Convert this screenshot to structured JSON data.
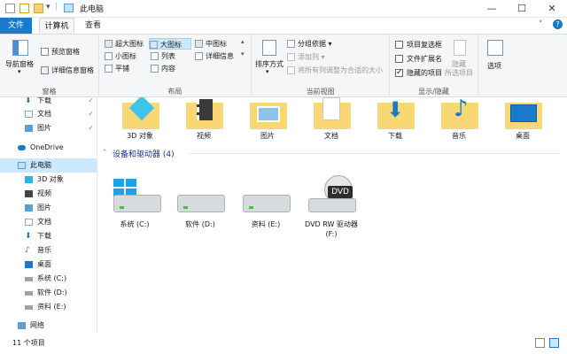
{
  "window": {
    "title": "此电脑",
    "controls": [
      "minimize-icon",
      "maximize-icon",
      "close-icon"
    ]
  },
  "tabs": {
    "file": "文件",
    "computer": "计算机",
    "view": "查看"
  },
  "ribbon": {
    "pane_group": {
      "nav_pane": "导航窗格",
      "preview_pane": "预览窗格",
      "details_pane": "详细信息窗格",
      "label": "窗格"
    },
    "layout_group": {
      "items": [
        "超大图标",
        "大图标",
        "中图标",
        "小图标",
        "列表",
        "详细信息",
        "平铺",
        "内容"
      ],
      "selected": "大图标",
      "label": "布局"
    },
    "current_view_group": {
      "sort_by": "排序方式",
      "group_by": "分组依据",
      "add_column": "添加列",
      "size_columns": "将所有列调整为合适的大小",
      "label": "当前视图"
    },
    "show_hide_group": {
      "item_checkboxes": "项目复选框",
      "file_extensions": "文件扩展名",
      "hidden_items": "隐藏的项目",
      "hidden_items_checked": true,
      "hide_selected_1": "隐藏",
      "hide_selected_2": "所选项目",
      "label": "显示/隐藏"
    },
    "options": "选项"
  },
  "nav": {
    "items": [
      {
        "label": "下载",
        "pinned": true
      },
      {
        "label": "文档",
        "pinned": true
      },
      {
        "label": "图片",
        "pinned": true
      },
      {
        "label": "OneDrive"
      },
      {
        "label": "此电脑",
        "selected": true
      },
      {
        "label": "3D 对象"
      },
      {
        "label": "视频"
      },
      {
        "label": "图片"
      },
      {
        "label": "文档"
      },
      {
        "label": "下载"
      },
      {
        "label": "音乐"
      },
      {
        "label": "桌面"
      },
      {
        "label": "系统 (C:)"
      },
      {
        "label": "软件 (D:)"
      },
      {
        "label": "资料 (E:)"
      },
      {
        "label": "网络"
      }
    ],
    "pin_glyph": "✓"
  },
  "folders": [
    "3D 对象",
    "视频",
    "图片",
    "文档",
    "下载",
    "音乐",
    "桌面"
  ],
  "devices": {
    "header": "设备和驱动器 (4)",
    "items": [
      {
        "label": "系统 (C:)",
        "icon": "windows-drive-icon"
      },
      {
        "label": "软件 (D:)",
        "icon": "drive-icon"
      },
      {
        "label": "资料 (E:)",
        "icon": "drive-icon"
      },
      {
        "label_line1": "DVD RW 驱动器",
        "label_line2": "(F:)",
        "icon": "dvd-drive-icon",
        "badge": "DVD"
      }
    ]
  },
  "status": {
    "count": "11 个项目"
  },
  "colors": {
    "accent": "#1979ca",
    "folder": "#f8d775",
    "selected": "#cce8ff",
    "section_header": "#1e3287"
  }
}
